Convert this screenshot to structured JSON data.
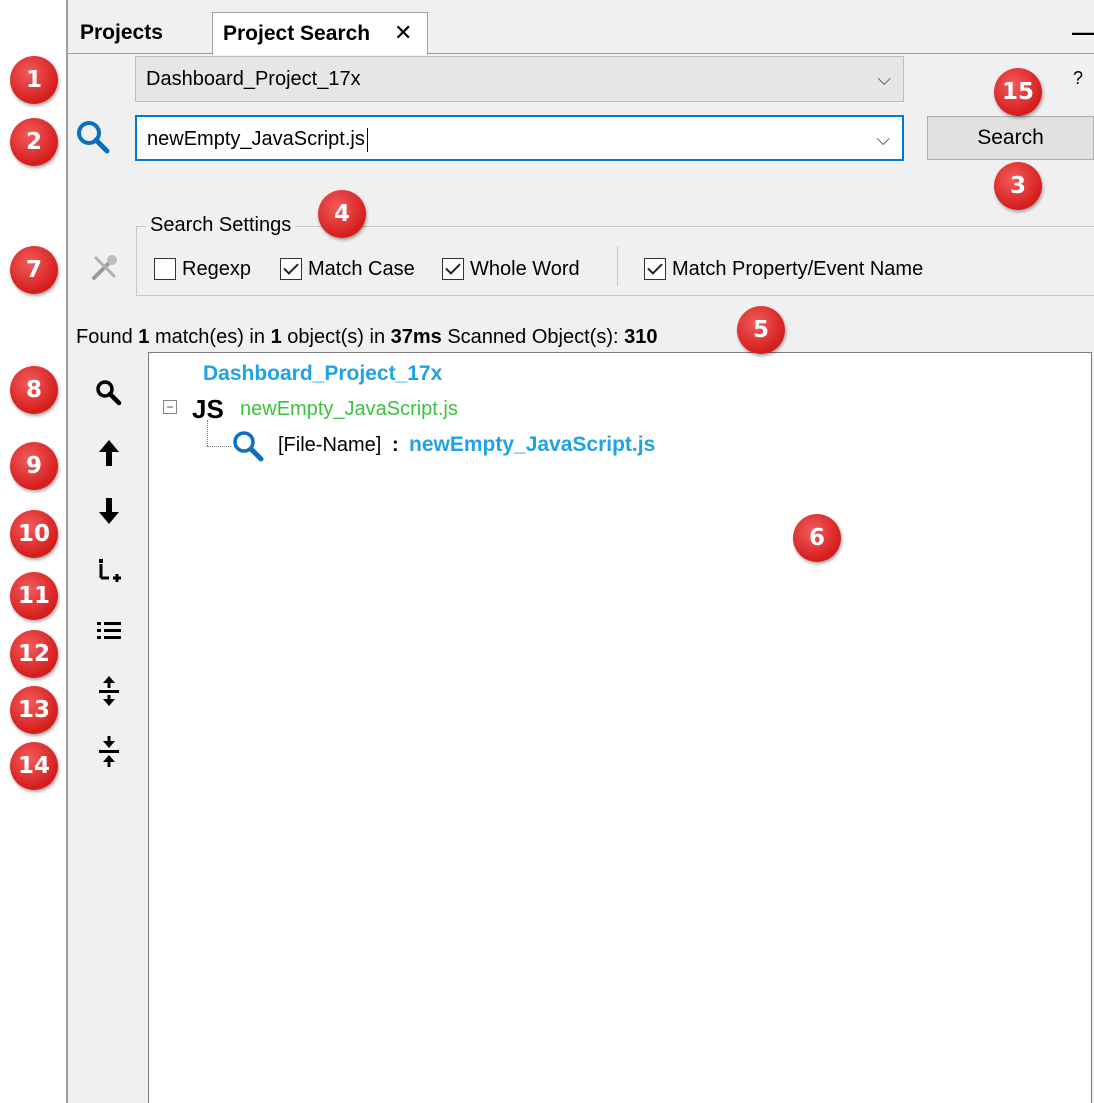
{
  "tabs": {
    "projects": "Projects",
    "project_search": "Project Search",
    "close": "✕"
  },
  "window": {
    "minimize": "—",
    "help": "?"
  },
  "project_combo": {
    "value": "Dashboard_Project_17x"
  },
  "search_combo": {
    "value": "newEmpty_JavaScript.js"
  },
  "search_button": "Search",
  "settings": {
    "title": "Search Settings",
    "regexp": {
      "label": "Regexp",
      "checked": false
    },
    "match_case": {
      "label": "Match Case",
      "checked": true
    },
    "whole_word": {
      "label": "Whole Word",
      "checked": true
    },
    "match_property": {
      "label": "Match Property/Event Name",
      "checked": true
    }
  },
  "status": {
    "found": "Found",
    "matches": "1",
    "matches_text": "match(es) in",
    "objects": "1",
    "objects_text": "object(s) in",
    "time": "37ms",
    "scanned_text": "Scanned Object(s):",
    "scanned": "310"
  },
  "results": {
    "root": "Dashboard_Project_17x",
    "file_tag": "JS",
    "file": "newEmpty_JavaScript.js",
    "match_kind": "[File-Name]",
    "match_sep": ":",
    "match_value": "newEmpty_JavaScript.js"
  },
  "toolbar_icons": [
    "search-icon",
    "arrow-up-icon",
    "arrow-down-icon",
    "expand-tree-icon",
    "list-icon",
    "expand-all-icon",
    "collapse-all-icon"
  ],
  "badges": [
    "1",
    "2",
    "3",
    "4",
    "5",
    "6",
    "7",
    "8",
    "9",
    "10",
    "11",
    "12",
    "13",
    "14",
    "15"
  ],
  "colors": {
    "accent": "#1fa3e6",
    "file_green": "#3cc23c",
    "badge_red": "#d51d1d",
    "focus_blue": "#0078d7"
  }
}
